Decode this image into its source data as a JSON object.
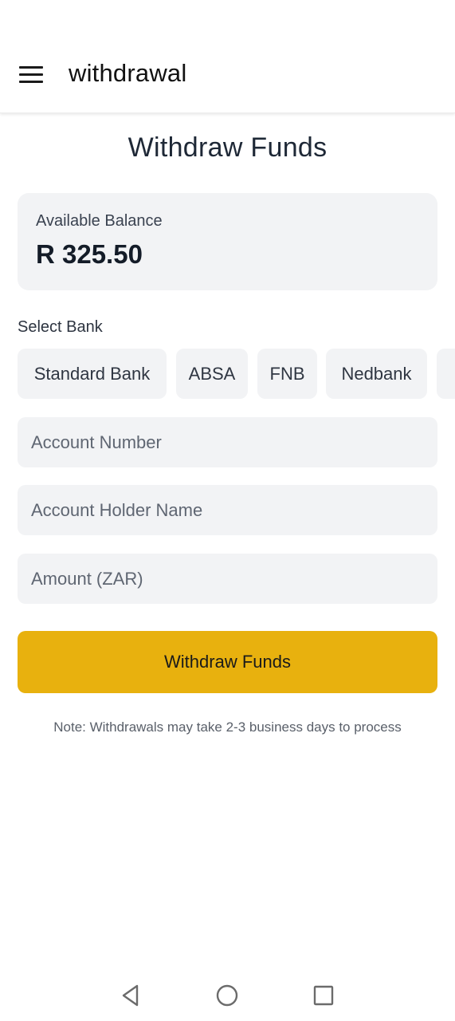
{
  "appbar": {
    "title": "withdrawal"
  },
  "page": {
    "title": "Withdraw Funds"
  },
  "balance": {
    "label": "Available Balance",
    "value": "R 325.50"
  },
  "bank_select": {
    "label": "Select Bank",
    "options": [
      "Standard Bank",
      "ABSA",
      "FNB",
      "Nedbank"
    ]
  },
  "form": {
    "account_number_placeholder": "Account Number",
    "account_holder_placeholder": "Account Holder Name",
    "amount_placeholder": "Amount (ZAR)",
    "submit_label": "Withdraw Funds"
  },
  "note": "Note: Withdrawals may take 2-3 business days to process",
  "colors": {
    "accent": "#e8b10e",
    "card_bg": "#f2f3f5"
  },
  "icons": {
    "menu": "hamburger-menu-icon",
    "back": "nav-back-icon",
    "home": "nav-home-icon",
    "recents": "nav-recents-icon"
  }
}
